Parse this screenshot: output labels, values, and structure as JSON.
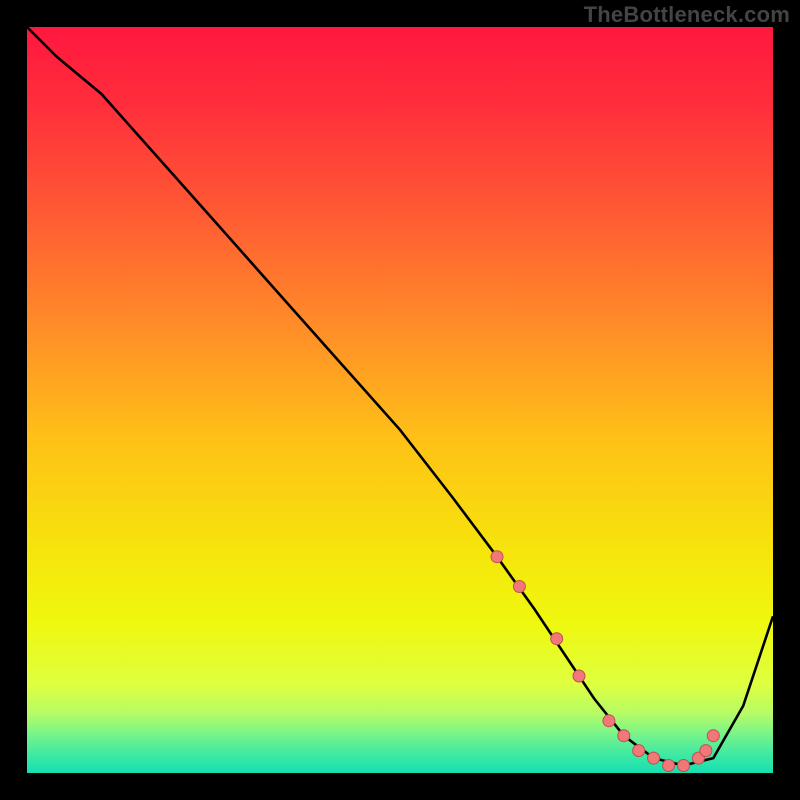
{
  "watermark": "TheBottleneck.com",
  "colors": {
    "frame": "#000000",
    "curve_stroke": "#000000",
    "marker_fill": "#F07878",
    "marker_stroke": "#C05050",
    "gradient_stops": [
      {
        "offset": 0.0,
        "color": "#FF173E"
      },
      {
        "offset": 0.1,
        "color": "#FF2D3C"
      },
      {
        "offset": 0.25,
        "color": "#FF5A33"
      },
      {
        "offset": 0.4,
        "color": "#FF8C28"
      },
      {
        "offset": 0.55,
        "color": "#FFC017"
      },
      {
        "offset": 0.7,
        "color": "#F6E40B"
      },
      {
        "offset": 0.8,
        "color": "#EFF80F"
      },
      {
        "offset": 0.88,
        "color": "#DFFF3F"
      },
      {
        "offset": 0.92,
        "color": "#B6FC66"
      },
      {
        "offset": 0.95,
        "color": "#73F38C"
      },
      {
        "offset": 0.975,
        "color": "#3FE9A2"
      },
      {
        "offset": 1.0,
        "color": "#16DFB1"
      }
    ]
  },
  "chart_data": {
    "type": "line",
    "title": "",
    "xlabel": "",
    "ylabel": "",
    "xlim": [
      0,
      100
    ],
    "ylim": [
      0,
      100
    ],
    "x": [
      0,
      4,
      10,
      18,
      26,
      34,
      42,
      50,
      57,
      63,
      68,
      72,
      76,
      80,
      84,
      88,
      92,
      96,
      100
    ],
    "values": [
      100,
      96,
      91,
      82,
      73,
      64,
      55,
      46,
      37,
      29,
      22,
      16,
      10,
      5,
      2,
      1,
      2,
      9,
      21
    ],
    "markers": {
      "x": [
        63,
        66,
        71,
        74,
        78,
        80,
        82,
        84,
        86,
        88,
        90,
        91,
        92
      ],
      "y": [
        29,
        25,
        18,
        13,
        7,
        5,
        3,
        2,
        1,
        1,
        2,
        3,
        5
      ]
    }
  }
}
